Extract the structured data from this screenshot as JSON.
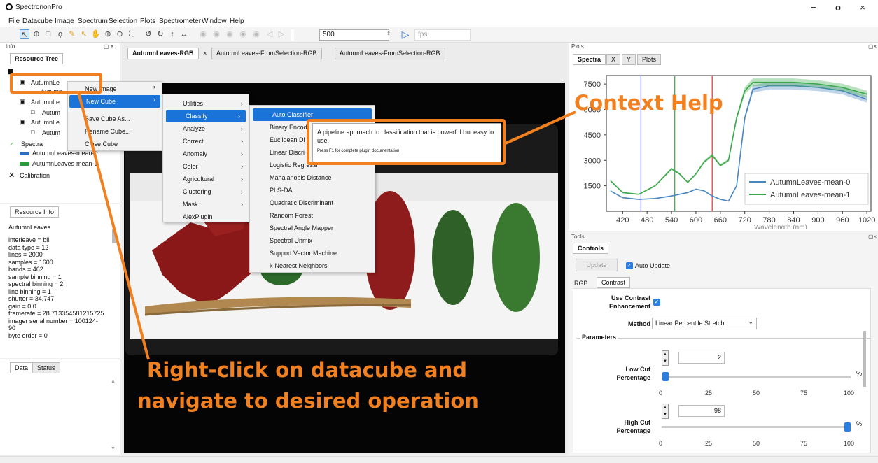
{
  "app": {
    "title": "SpectrononPro",
    "minimize": "−",
    "maximize": "o",
    "close": "×"
  },
  "menu": [
    "File",
    "Datacube",
    "Image",
    "Spectrum",
    "Selection",
    "Plots",
    "Spectrometer",
    "Window",
    "Help"
  ],
  "toolbar": {
    "frame_value": "500",
    "fps_label": "fps:"
  },
  "info_panel": {
    "header": "Info",
    "tab": "Resource Tree"
  },
  "tree": [
    "AutumnLe",
    "Autumn",
    "AutumnLe",
    "Autum",
    "AutumnLe",
    "Autum",
    "Spectra",
    "AutumnLeaves-mean-0",
    "AutumnLeaves-mean-1",
    "Calibration"
  ],
  "resource_info": {
    "tab": "Resource Info",
    "name": "AutumnLeaves",
    "lines": [
      "interleave = bil",
      "data type = 12",
      "lines = 2000",
      "samples = 1600",
      "bands = 462",
      "sample binning = 1",
      "spectral binning = 2",
      "line binning = 1",
      "shutter = 34.747",
      "gain = 0.0",
      "framerate = 28.713354581215725",
      "imager serial number = 100124-",
      "90",
      "byte order = 0"
    ]
  },
  "bottom_tabs": [
    "Data",
    "Status"
  ],
  "doc_tabs": [
    "AutumnLeaves-RGB",
    "AutumnLeaves-FromSelection-RGB",
    "AutumnLeaves-FromSelection-RGB"
  ],
  "context_menu": [
    "New Image",
    "New Cube",
    "Save Cube As...",
    "Rename Cube...",
    "Close Cube"
  ],
  "new_cube_menu": [
    "Utilities",
    "Classify",
    "Analyze",
    "Correct",
    "Anomaly",
    "Color",
    "Agricultural",
    "Clustering",
    "Mask",
    "AlexPlugin"
  ],
  "classify_menu": [
    "Auto Classifier",
    "Binary Encod",
    "Euclidean Di",
    "Linear Discri",
    "Logistic Regressi",
    "Mahalanobis Distance",
    "PLS-DA",
    "Quadratic Discriminant",
    "Random Forest",
    "Spectral Angle Mapper",
    "Spectral Unmix",
    "Support Vector Machine",
    "k-Nearest Neighbors"
  ],
  "tooltip": {
    "text": "A pipeline approach to classification that is powerful but easy to use.",
    "hint": "Press F1 for complete plugin documentation"
  },
  "annotations": {
    "context_help": "Context Help",
    "instruction_1": "Right-click on datacube and",
    "instruction_2": "navigate to desired operation"
  },
  "plots_panel": {
    "header": "Plots",
    "tabs": [
      "Spectra",
      "X",
      "Y",
      "Plots"
    ]
  },
  "chart_data": {
    "type": "line",
    "xlabel": "Wavelength (nm)",
    "xticks": [
      420,
      480,
      540,
      600,
      660,
      720,
      780,
      840,
      900,
      960,
      1020
    ],
    "yticks": [
      1500,
      3000,
      4500,
      6000,
      7500
    ],
    "xlim": [
      380,
      1030
    ],
    "ylim": [
      0,
      8000
    ],
    "vlines": [
      {
        "x": 465,
        "color": "#3344cc"
      },
      {
        "x": 548,
        "color": "#33aa44"
      },
      {
        "x": 640,
        "color": "#dd3333"
      }
    ],
    "series": [
      {
        "name": "AutumnLeaves-mean-0",
        "color": "#4a86c0",
        "x": [
          390,
          420,
          460,
          500,
          540,
          560,
          580,
          600,
          620,
          640,
          660,
          680,
          700,
          720,
          740,
          780,
          840,
          900,
          960,
          1020
        ],
        "y": [
          1200,
          800,
          700,
          750,
          900,
          1000,
          1100,
          1300,
          1200,
          900,
          700,
          600,
          1500,
          5500,
          7200,
          7400,
          7400,
          7300,
          7100,
          6600
        ]
      },
      {
        "name": "AutumnLeaves-mean-1",
        "color": "#3aa84a",
        "x": [
          390,
          420,
          460,
          500,
          540,
          560,
          580,
          600,
          620,
          640,
          660,
          680,
          700,
          720,
          740,
          780,
          840,
          900,
          960,
          1020
        ],
        "y": [
          1800,
          1100,
          1000,
          1500,
          2500,
          2200,
          1700,
          2200,
          2900,
          3300,
          2700,
          3000,
          5500,
          7100,
          7600,
          7600,
          7600,
          7500,
          7300,
          6900
        ]
      }
    ],
    "legend": "bottom-right"
  },
  "tools_panel": {
    "header": "Tools",
    "tab": "Controls",
    "update": "Update",
    "auto_update": "Auto Update",
    "subtabs": [
      "RGB",
      "Contrast"
    ],
    "use_contrast": "Use Contrast",
    "enhancement": "Enhancement",
    "method_label": "Method",
    "method_value": "Linear Percentile Stretch",
    "parameters": "Parameters",
    "low_cut_1": "Low Cut",
    "low_cut_2": "Percentage",
    "low_value": "2",
    "low_percent": 2,
    "high_cut_1": "High Cut",
    "high_cut_2": "Percentage",
    "high_value": "98",
    "high_percent": 98,
    "percent": "%",
    "ticks": [
      "0",
      "25",
      "50",
      "75",
      "100"
    ]
  }
}
